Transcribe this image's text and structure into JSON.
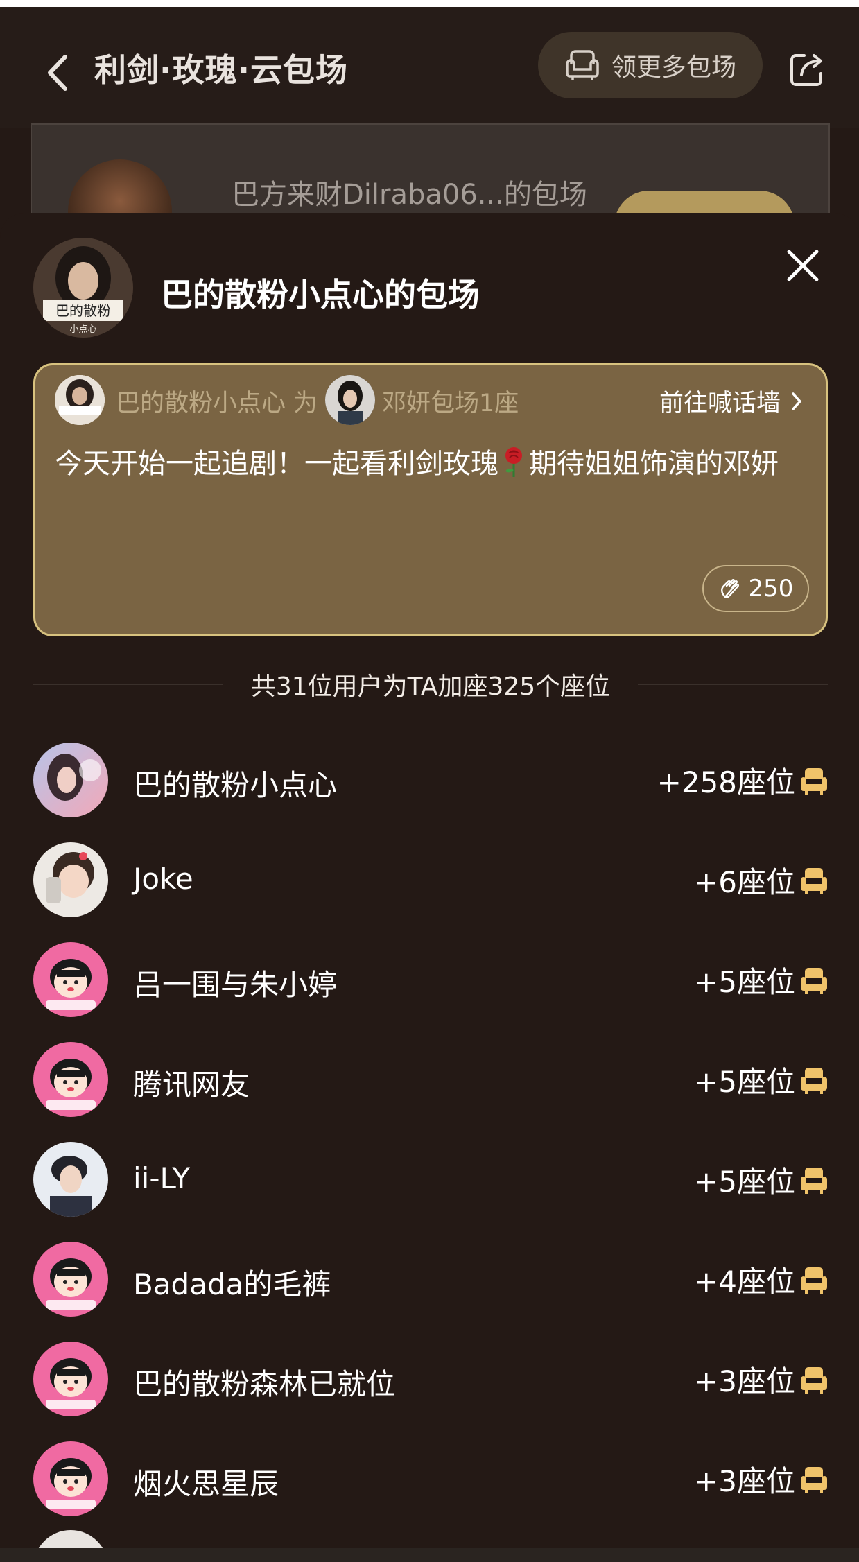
{
  "header": {
    "title": "利剑·玫瑰·云包场",
    "more_button_label": "领更多包场"
  },
  "background_card": {
    "text": "巴方来财Dilraba06...的包场"
  },
  "sheet": {
    "host_name": "巴的散粉小点心的包场",
    "host_avatar_text_top": "巴的散粉",
    "host_avatar_text_bottom": "小点心",
    "message": {
      "from_name": "巴的散粉小点心",
      "connector": "为",
      "to_text": "邓妍包场1座",
      "wall_link": "前往喊话墙",
      "body_before": "今天开始一起追剧！一起看利剑玫瑰",
      "body_after": "期待姐姐饰演的邓妍",
      "clap_count": "250"
    },
    "summary": "共31位用户为TA加座325个座位",
    "supporters": [
      {
        "name": "巴的散粉小点心",
        "seats": "+258座位",
        "avatar_style": "photo-pink"
      },
      {
        "name": "Joke",
        "seats": "+6座位",
        "avatar_style": "photo-child"
      },
      {
        "name": "吕一围与朱小婷",
        "seats": "+5座位",
        "avatar_style": "cartoon-pink"
      },
      {
        "name": "腾讯网友",
        "seats": "+5座位",
        "avatar_style": "cartoon-pink"
      },
      {
        "name": "ii-LY",
        "seats": "+5座位",
        "avatar_style": "photo-uniform"
      },
      {
        "name": "Badada的毛裤",
        "seats": "+4座位",
        "avatar_style": "cartoon-pink"
      },
      {
        "name": "巴的散粉森林已就位",
        "seats": "+3座位",
        "avatar_style": "cartoon-pink"
      },
      {
        "name": "烟火思星辰",
        "seats": "+3座位",
        "avatar_style": "cartoon-pink"
      }
    ]
  },
  "colors": {
    "background": "#241915",
    "card_fill": "#7a6443",
    "card_border": "#d8c27f",
    "seat_icon": "#f0c36a"
  }
}
